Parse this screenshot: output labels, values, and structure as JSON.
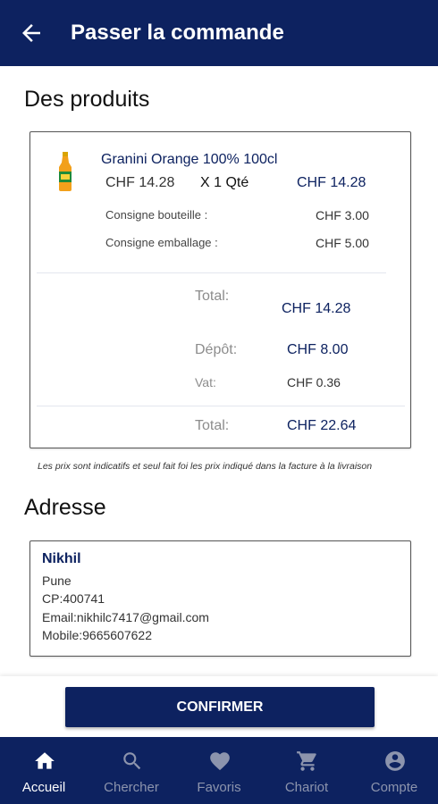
{
  "header": {
    "title": "Passer la commande"
  },
  "products_section": {
    "title": "Des produits",
    "items": [
      {
        "name": "Granini Orange 100% 100cl",
        "unit_price": "CHF 14.28",
        "quantity": "X 1 Qté",
        "line_total": "CHF 14.28",
        "fees": [
          {
            "label": "Consigne bouteille :",
            "value": "CHF 3.00"
          },
          {
            "label": "Consigne emballage :",
            "value": "CHF 5.00"
          }
        ]
      }
    ],
    "summary": {
      "subtotal_label": "Total:",
      "subtotal_value": "CHF 14.28",
      "deposit_label": "Dépôt:",
      "deposit_value": "CHF 8.00",
      "vat_label": "Vat:",
      "vat_value": "CHF 0.36",
      "total_label": "Total:",
      "total_value": "CHF 22.64"
    },
    "note": "Les prix sont indicatifs et seul fait foi les prix indiqué dans la facture à la livraison"
  },
  "address_section": {
    "title": "Adresse",
    "name": "Nikhil",
    "city": "Pune",
    "postal_code": "CP:400741",
    "email": "Email:nikhilc7417@gmail.com",
    "mobile": "Mobile:9665607622"
  },
  "confirm_button": "CONFIRMER",
  "bottom_nav": [
    {
      "label": "Accueil",
      "icon": "home-icon",
      "active": true
    },
    {
      "label": "Chercher",
      "icon": "search-icon",
      "active": false
    },
    {
      "label": "Favoris",
      "icon": "heart-icon",
      "active": false
    },
    {
      "label": "Chariot",
      "icon": "cart-icon",
      "active": false
    },
    {
      "label": "Compte",
      "icon": "account-icon",
      "active": false
    }
  ],
  "colors": {
    "primary": "#0d2260",
    "inactive_nav": "#8c94ad",
    "muted_label": "#8c8c8c"
  }
}
